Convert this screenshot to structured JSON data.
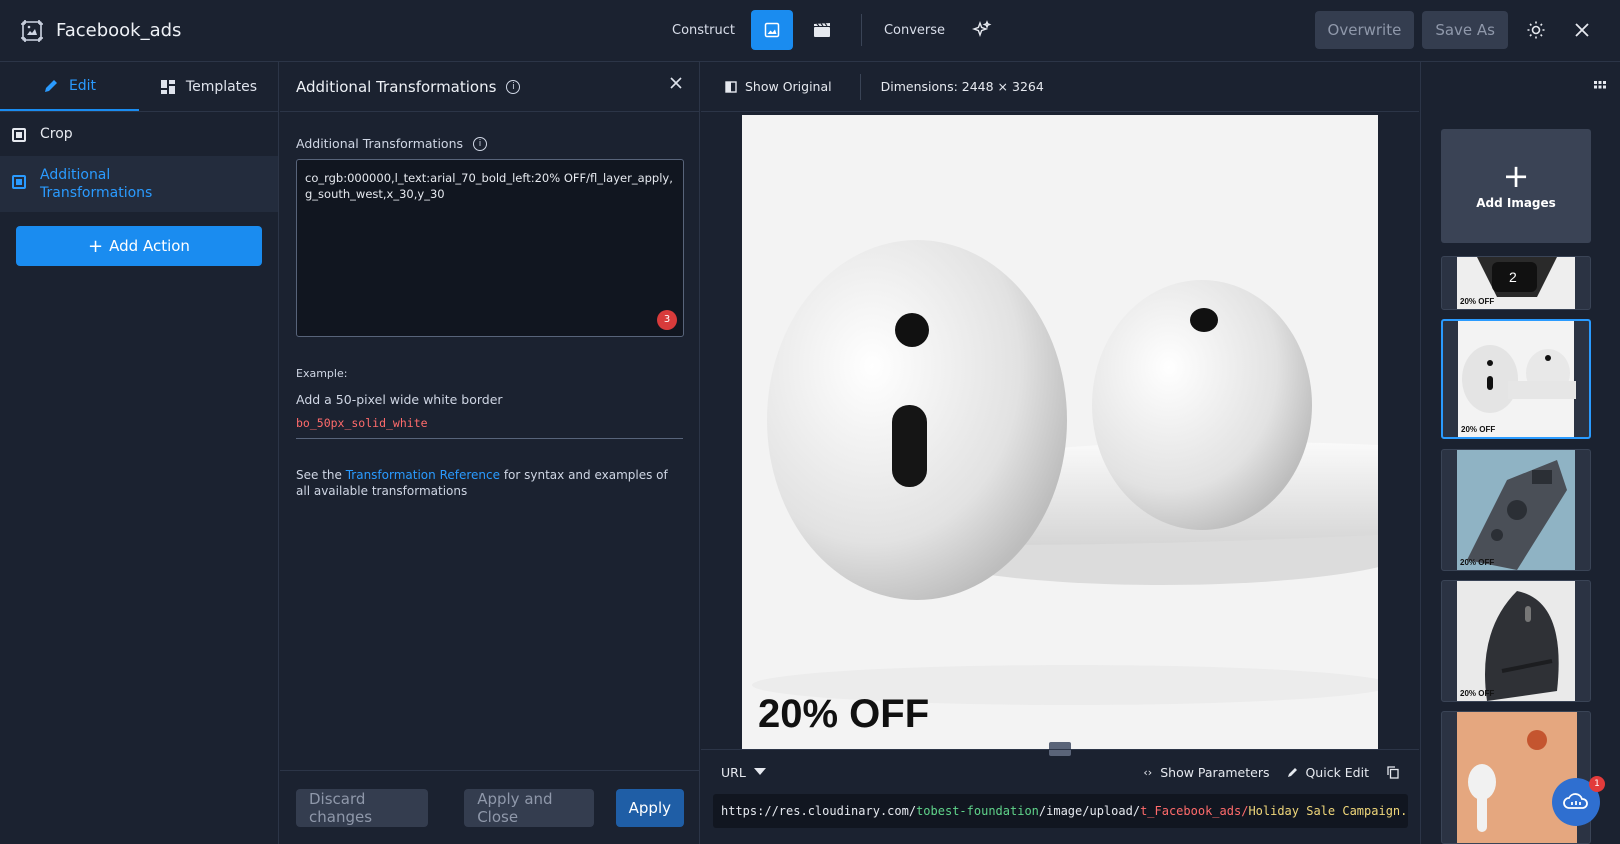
{
  "header": {
    "title": "Facebook_ads",
    "construct_label": "Construct",
    "converse_label": "Converse",
    "overwrite_label": "Overwrite",
    "save_as_label": "Save As"
  },
  "left": {
    "tabs": [
      {
        "label": "Edit"
      },
      {
        "label": "Templates"
      }
    ],
    "items": [
      {
        "label": "Crop"
      },
      {
        "label": "Additional Transformations"
      }
    ],
    "add_action_label": "Add Action"
  },
  "panel": {
    "title": "Additional Transformations",
    "field_label": "Additional Transformations",
    "textarea_value": "co_rgb:000000,l_text:arial_70_bold_left:20% OFF/fl_layer_apply,g_south_west,x_30,y_30",
    "issue_count": "3",
    "example_label": "Example:",
    "example_desc": "Add a 50-pixel wide white border",
    "example_code": "bo_50px_solid_white",
    "ref_prefix": "See the ",
    "ref_link": "Transformation Reference",
    "ref_suffix": " for syntax and examples of all available transformations",
    "discard_label": "Discard changes",
    "apply_close_label": "Apply and Close",
    "apply_label": "Apply"
  },
  "preview": {
    "show_original_label": "Show Original",
    "dimensions": "Dimensions: 2448 × 3264",
    "image_overlay_text": "20% OFF",
    "url_mode": "URL",
    "show_params_label": "Show Parameters",
    "quick_edit_label": "Quick Edit",
    "url_parts": {
      "base": "https://res.cloudinary.com/",
      "cloud": "tobest-foundation",
      "path": "/image/upload/",
      "transform": "t_Facebook_ads/",
      "asset": "Holiday Sale Campaign."
    }
  },
  "rail": {
    "add_images_label": "Add Images",
    "thumb_caption": "20% OFF"
  },
  "chat": {
    "badge": "1"
  },
  "colors": {
    "accent": "#1a8cf0",
    "background": "#1b2230",
    "danger": "#d83b3b"
  }
}
